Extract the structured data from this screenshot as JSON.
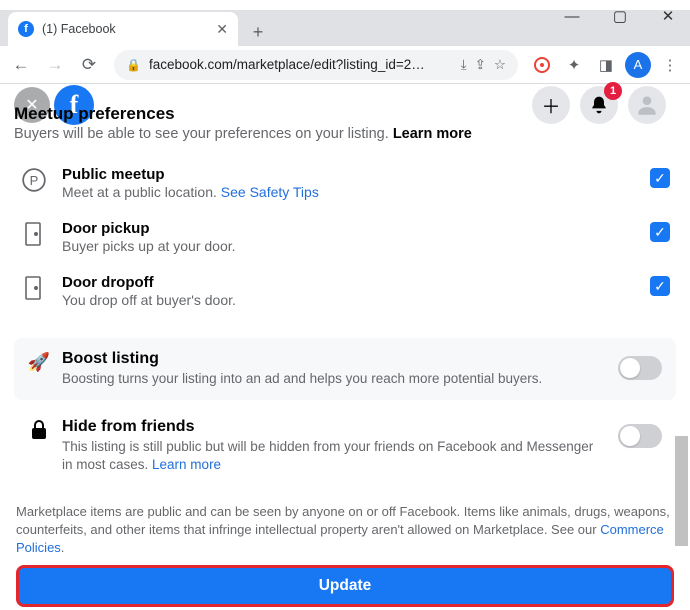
{
  "window": {
    "tab_title": "(1) Facebook",
    "url": "facebook.com/marketplace/edit?listing_id=2…"
  },
  "fb_header": {
    "notification_count": "1",
    "profile_letter": "A"
  },
  "meetup": {
    "title": "Meetup preferences",
    "subtitle": "Buyers will be able to see your preferences on your listing. ",
    "learn_more": "Learn more",
    "items": [
      {
        "title": "Public meetup",
        "desc_prefix": "Meet at a public location. ",
        "link": "See Safety Tips",
        "checked": true
      },
      {
        "title": "Door pickup",
        "desc": "Buyer picks up at your door.",
        "checked": true
      },
      {
        "title": "Door dropoff",
        "desc": "You drop off at buyer's door.",
        "checked": true
      }
    ]
  },
  "boost": {
    "title": "Boost listing",
    "desc": "Boosting turns your listing into an ad and helps you reach more potential buyers."
  },
  "hide": {
    "title": "Hide from friends",
    "desc": "This listing is still public but will be hidden from your friends on Facebook and Messenger in most cases. ",
    "learn_more": "Learn more"
  },
  "footer": {
    "text": "Marketplace items are public and can be seen by anyone on or off Facebook. Items like animals, drugs, weapons, counterfeits, and other items that infringe intellectual property aren't allowed on Marketplace. See our ",
    "link": "Commerce Policies",
    "period": "."
  },
  "update_label": "Update"
}
